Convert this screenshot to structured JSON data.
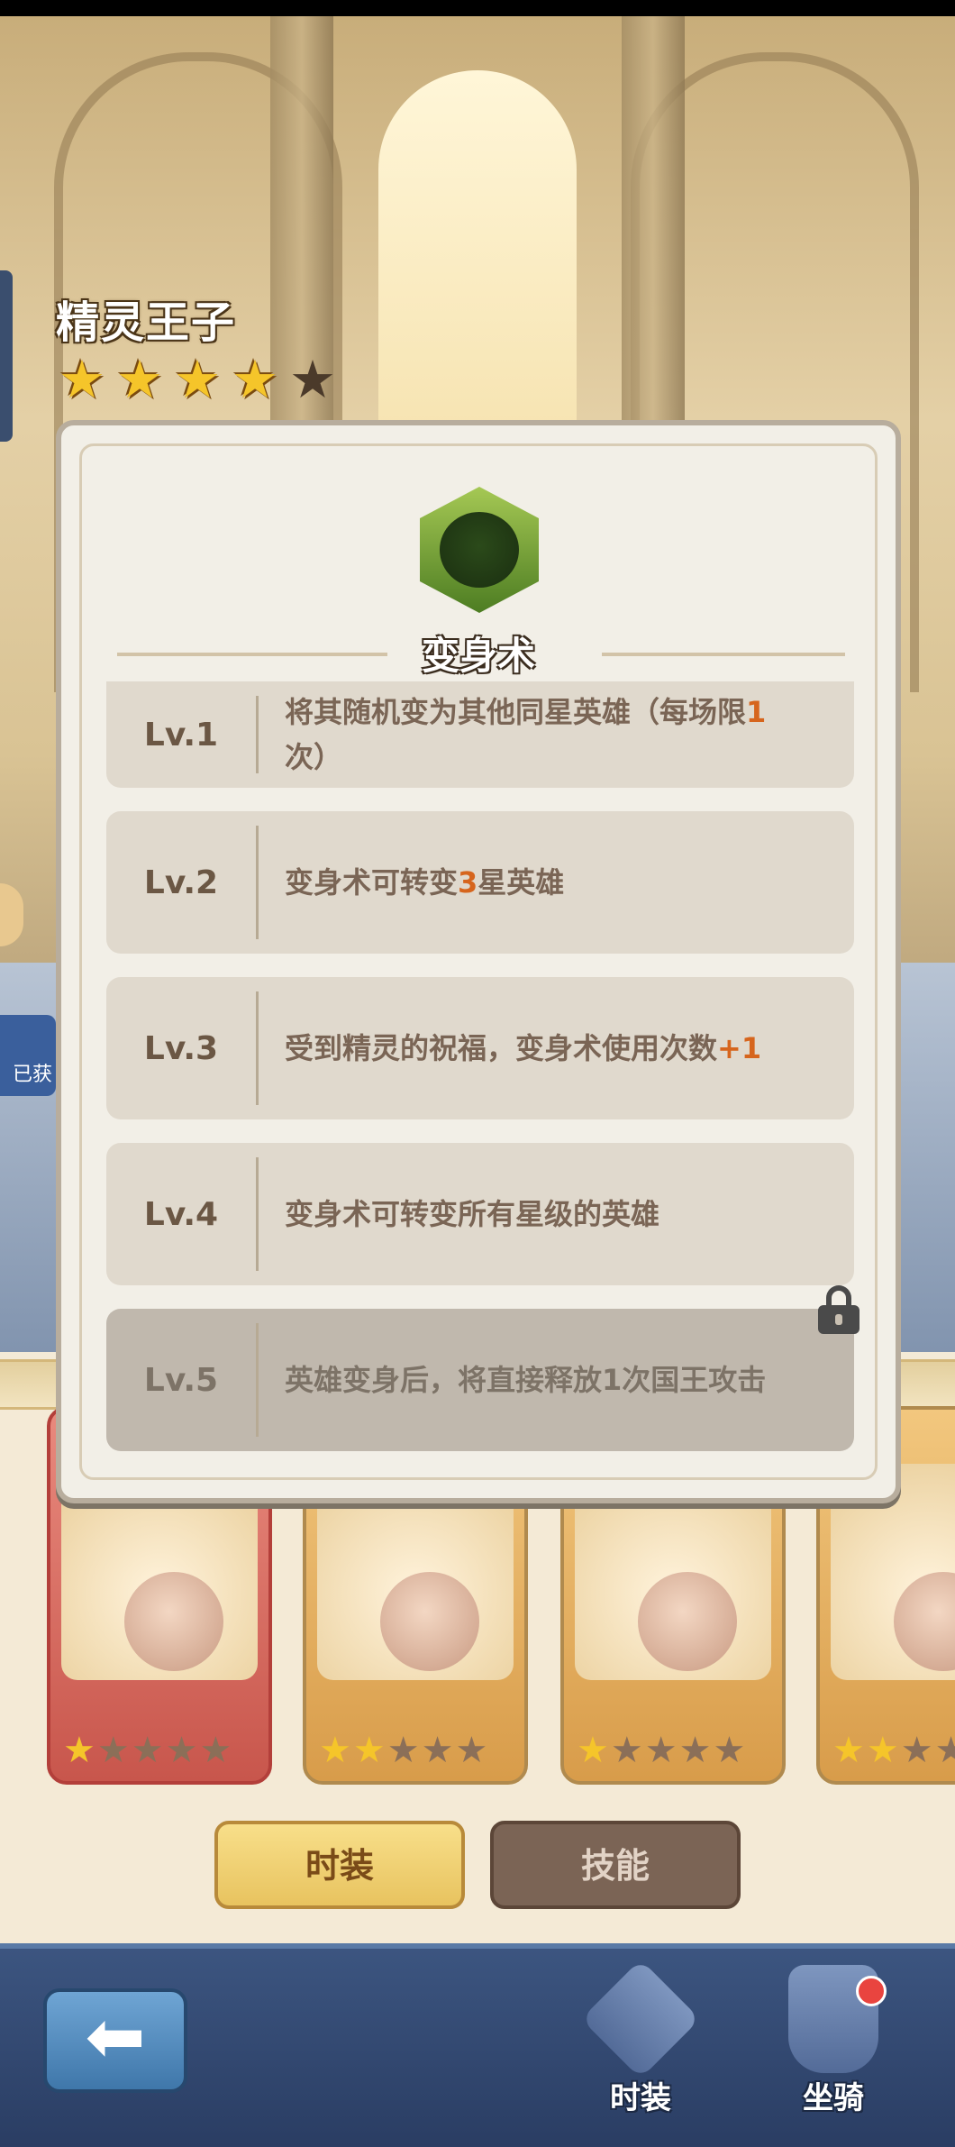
{
  "hero": {
    "name": "精灵王子",
    "stars_filled": 4,
    "stars_total": 5
  },
  "side": {
    "obtained_label": "已获"
  },
  "skill": {
    "name": "变身术",
    "levels": [
      {
        "label": "Lv.1",
        "text_parts": [
          "将其随机变为其他同星英雄（每场限",
          "1",
          "次）"
        ],
        "locked": false
      },
      {
        "label": "Lv.2",
        "text_parts": [
          "变身术可转变",
          "3",
          "星英雄"
        ],
        "locked": false
      },
      {
        "label": "Lv.3",
        "text_parts": [
          "受到精灵的祝福，变身术使用次数",
          "+1",
          ""
        ],
        "locked": false
      },
      {
        "label": "Lv.4",
        "text_parts": [
          "变身术可转变所有星级的英雄",
          "",
          ""
        ],
        "locked": false
      },
      {
        "label": "Lv.5",
        "text_parts": [
          "英雄变身后，将直接释放1次国王攻击",
          "",
          ""
        ],
        "locked": true
      }
    ]
  },
  "skins": [
    {
      "stars_filled": 1,
      "stars_total": 5,
      "frame": "red"
    },
    {
      "stars_filled": 2,
      "stars_total": 5,
      "frame": "gold"
    },
    {
      "stars_filled": 1,
      "stars_total": 5,
      "frame": "gold"
    },
    {
      "stars_filled": 2,
      "stars_total": 5,
      "frame": "gold"
    }
  ],
  "tabs": {
    "costume": "时装",
    "skill": "技能"
  },
  "nav": {
    "costume": "时装",
    "mount": "坐骑",
    "back_icon": "arrow-left-icon"
  },
  "colors": {
    "highlight": "#d6651d",
    "star": "#f5c52a",
    "badge": "#e9443f"
  }
}
